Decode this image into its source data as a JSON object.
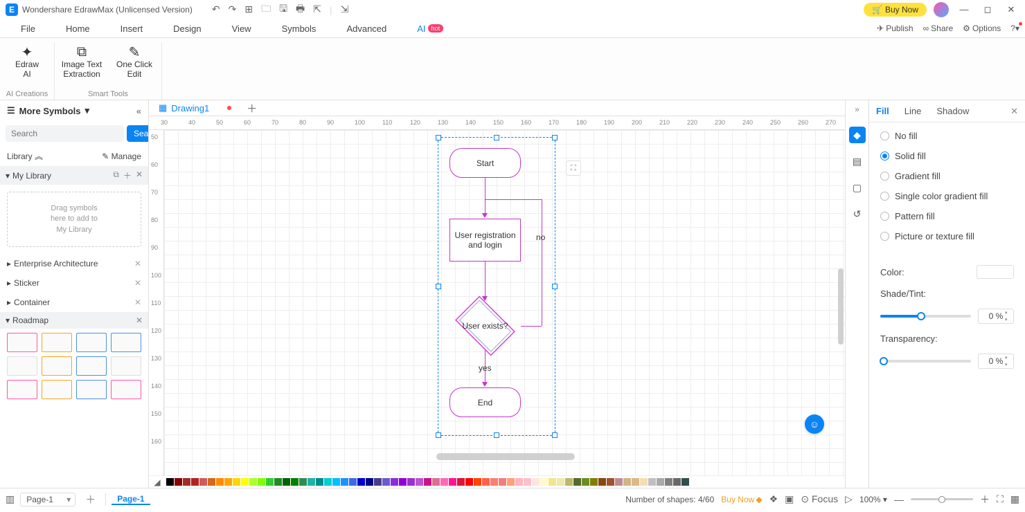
{
  "titlebar": {
    "app_title": "Wondershare EdrawMax (Unlicensed Version)",
    "buy_now": "Buy Now"
  },
  "menus": [
    "File",
    "Home",
    "Insert",
    "Design",
    "View",
    "Symbols",
    "Advanced",
    "AI"
  ],
  "hot": "hot",
  "top_right": {
    "publish": "Publish",
    "share": "Share",
    "options": "Options"
  },
  "ribbon": {
    "group1": {
      "label": "AI Creations",
      "btn1": "Edraw\nAI"
    },
    "group2": {
      "label": "Smart Tools",
      "btn1": "Image Text\nExtraction",
      "btn2": "One Click\nEdit"
    }
  },
  "left": {
    "more_symbols": "More Symbols",
    "search_placeholder": "Search",
    "search_btn": "Search",
    "library": "Library",
    "manage": "Manage",
    "my_library": "My Library",
    "drop_hint": "Drag symbols\nhere to add to\nMy Library",
    "cats": [
      "Enterprise Architecture",
      "Sticker",
      "Container",
      "Roadmap"
    ]
  },
  "tab": {
    "name": "Drawing1"
  },
  "shapes": {
    "start": "Start",
    "proc": "User registration and login",
    "dec": "User exists?",
    "end": "End",
    "yes": "yes",
    "no": "no"
  },
  "right_panel": {
    "tabs": [
      "Fill",
      "Line",
      "Shadow"
    ],
    "opts": [
      "No fill",
      "Solid fill",
      "Gradient fill",
      "Single color gradient fill",
      "Pattern fill",
      "Picture or texture fill"
    ],
    "color": "Color:",
    "shade": "Shade/Tint:",
    "transparency": "Transparency:",
    "pct0": "0 %"
  },
  "status": {
    "page": "Page-1",
    "page_tab": "Page-1",
    "shapes_lbl": "Number of shapes:",
    "shapes_val": "4/60",
    "buy": "Buy Now",
    "focus": "Focus",
    "zoom": "100%"
  },
  "ruler_h": [
    "30",
    "40",
    "50",
    "60",
    "70",
    "80",
    "90",
    "100",
    "110",
    "120",
    "130",
    "140",
    "150",
    "160",
    "170",
    "180",
    "190",
    "200",
    "210",
    "220",
    "230",
    "240",
    "250",
    "260",
    "270"
  ],
  "ruler_v": [
    "50",
    "60",
    "70",
    "80",
    "90",
    "100",
    "110",
    "120",
    "130",
    "140",
    "150",
    "160"
  ],
  "palette": [
    "#000000",
    "#8b0000",
    "#a52a2a",
    "#b22222",
    "#cd5c5c",
    "#d2691e",
    "#ff8c00",
    "#ffa500",
    "#ffd700",
    "#ffff00",
    "#adff2f",
    "#7fff00",
    "#32cd32",
    "#228b22",
    "#006400",
    "#008000",
    "#2e8b57",
    "#20b2aa",
    "#008b8b",
    "#00ced1",
    "#00bfff",
    "#1e90ff",
    "#4169e1",
    "#0000cd",
    "#00008b",
    "#483d8b",
    "#6a5acd",
    "#8a2be2",
    "#9400d3",
    "#9932cc",
    "#ba55d3",
    "#c71585",
    "#db7093",
    "#ff69b4",
    "#ff1493",
    "#dc143c",
    "#ff0000",
    "#ff4500",
    "#ff6347",
    "#fa8072",
    "#f08080",
    "#ffa07a",
    "#ffb6c1",
    "#ffc0cb",
    "#ffe4e1",
    "#fffacd",
    "#f0e68c",
    "#eee8aa",
    "#bdb76b",
    "#556b2f",
    "#6b8e23",
    "#808000",
    "#8b4513",
    "#a0522d",
    "#bc8f8f",
    "#d2b48c",
    "#deb887",
    "#f5deb3",
    "#c0c0c0",
    "#a9a9a9",
    "#808080",
    "#696969",
    "#2f4f4f"
  ]
}
